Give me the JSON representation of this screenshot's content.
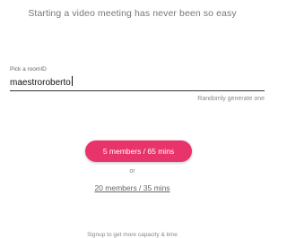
{
  "tagline": "Starting a video meeting has never been so easy",
  "room": {
    "label": "Pick a roomID",
    "value": "maestroroberto",
    "random_link": "Randomly generate one"
  },
  "actions": {
    "primary_button": "5 members / 65 mins",
    "separator": "or",
    "alternative_link": "20 members / 35 mins"
  },
  "footer": {
    "signup_note": "Signup to get more capacity & time"
  },
  "colors": {
    "accent": "#e8336b"
  }
}
